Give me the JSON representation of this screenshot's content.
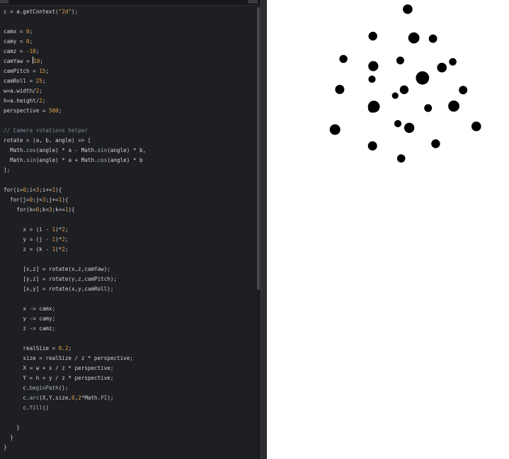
{
  "editor": {
    "language": "javascript",
    "cursor": {
      "line": 6,
      "column": 10
    },
    "colors": {
      "background": "#1e1f22",
      "default": "#d4d4d4",
      "keyword": "#d4d4d4",
      "number": "#e2a14a",
      "string": "#d9a55c",
      "property": "#a9b0b8",
      "comment": "#7b8799",
      "operator": "#d4d4d4"
    },
    "lines": [
      [
        {
          "t": "c = a.getContext(",
          "k": "default"
        },
        {
          "t": "\"2d\"",
          "k": "string"
        },
        {
          "t": ");",
          "k": "default"
        }
      ],
      [],
      [
        {
          "t": "camx = ",
          "k": "default"
        },
        {
          "t": "0",
          "k": "number"
        },
        {
          "t": ";",
          "k": "default"
        }
      ],
      [
        {
          "t": "camy = ",
          "k": "default"
        },
        {
          "t": "0",
          "k": "number"
        },
        {
          "t": ";",
          "k": "default"
        }
      ],
      [
        {
          "t": "camz = ",
          "k": "default"
        },
        {
          "t": "-10",
          "k": "number"
        },
        {
          "t": ";",
          "k": "default"
        }
      ],
      [
        {
          "t": "camYaw = ",
          "k": "default"
        },
        {
          "t": "10",
          "k": "number"
        },
        {
          "t": ";",
          "k": "default"
        }
      ],
      [
        {
          "t": "camPitch = ",
          "k": "default"
        },
        {
          "t": "15",
          "k": "number"
        },
        {
          "t": ";",
          "k": "default"
        }
      ],
      [
        {
          "t": "camRoll = ",
          "k": "default"
        },
        {
          "t": "25",
          "k": "number"
        },
        {
          "t": ";",
          "k": "default"
        }
      ],
      [
        {
          "t": "w=a.width/",
          "k": "default"
        },
        {
          "t": "2",
          "k": "number"
        },
        {
          "t": ";",
          "k": "default"
        }
      ],
      [
        {
          "t": "h=a.height/",
          "k": "default"
        },
        {
          "t": "2",
          "k": "number"
        },
        {
          "t": ";",
          "k": "default"
        }
      ],
      [
        {
          "t": "perspective = ",
          "k": "default"
        },
        {
          "t": "500",
          "k": "number"
        },
        {
          "t": ";",
          "k": "default"
        }
      ],
      [],
      [
        {
          "t": "// Camera rotations helper",
          "k": "comment"
        }
      ],
      [
        {
          "t": "rotate = (a, b, angle) => [",
          "k": "default"
        }
      ],
      [
        {
          "t": "  Math.",
          "k": "default"
        },
        {
          "t": "cos",
          "k": "property"
        },
        {
          "t": "(angle) * a - Math.",
          "k": "default"
        },
        {
          "t": "sin",
          "k": "property"
        },
        {
          "t": "(angle) * b,",
          "k": "default"
        }
      ],
      [
        {
          "t": "  Math.",
          "k": "default"
        },
        {
          "t": "sin",
          "k": "property"
        },
        {
          "t": "(angle) * a + Math.",
          "k": "default"
        },
        {
          "t": "cos",
          "k": "property"
        },
        {
          "t": "(angle) * b",
          "k": "default"
        }
      ],
      [
        {
          "t": "];",
          "k": "default"
        }
      ],
      [],
      [
        {
          "t": "for(i=",
          "k": "default"
        },
        {
          "t": "0",
          "k": "number"
        },
        {
          "t": ";i<",
          "k": "default"
        },
        {
          "t": "3",
          "k": "number"
        },
        {
          "t": ";i+=",
          "k": "default"
        },
        {
          "t": "1",
          "k": "number"
        },
        {
          "t": "){",
          "k": "default"
        }
      ],
      [
        {
          "t": "  for(j=",
          "k": "default"
        },
        {
          "t": "0",
          "k": "number"
        },
        {
          "t": ";j<",
          "k": "default"
        },
        {
          "t": "3",
          "k": "number"
        },
        {
          "t": ";j+=",
          "k": "default"
        },
        {
          "t": "1",
          "k": "number"
        },
        {
          "t": "){",
          "k": "default"
        }
      ],
      [
        {
          "t": "    for(k=",
          "k": "default"
        },
        {
          "t": "0",
          "k": "number"
        },
        {
          "t": ";k<",
          "k": "default"
        },
        {
          "t": "3",
          "k": "number"
        },
        {
          "t": ";k+=",
          "k": "default"
        },
        {
          "t": "1",
          "k": "number"
        },
        {
          "t": "){",
          "k": "default"
        }
      ],
      [],
      [
        {
          "t": "      x = (i - ",
          "k": "default"
        },
        {
          "t": "1",
          "k": "number"
        },
        {
          "t": ")*",
          "k": "default"
        },
        {
          "t": "2",
          "k": "number"
        },
        {
          "t": ";",
          "k": "default"
        }
      ],
      [
        {
          "t": "      y = (j - ",
          "k": "default"
        },
        {
          "t": "1",
          "k": "number"
        },
        {
          "t": ")*",
          "k": "default"
        },
        {
          "t": "2",
          "k": "number"
        },
        {
          "t": ";",
          "k": "default"
        }
      ],
      [
        {
          "t": "      z = (k - ",
          "k": "default"
        },
        {
          "t": "1",
          "k": "number"
        },
        {
          "t": ")*",
          "k": "default"
        },
        {
          "t": "2",
          "k": "number"
        },
        {
          "t": ";",
          "k": "default"
        }
      ],
      [],
      [
        {
          "t": "      [x,z] = rotate(x,z,camYaw);",
          "k": "default"
        }
      ],
      [
        {
          "t": "      [y,z] = rotate(y,z,camPitch);",
          "k": "default"
        }
      ],
      [
        {
          "t": "      [x,y] = rotate(x,y,camRoll);",
          "k": "default"
        }
      ],
      [],
      [
        {
          "t": "      x -= camx;",
          "k": "default"
        }
      ],
      [
        {
          "t": "      y -= camy;",
          "k": "default"
        }
      ],
      [
        {
          "t": "      z -= camz;",
          "k": "default"
        }
      ],
      [],
      [
        {
          "t": "      realSize = ",
          "k": "default"
        },
        {
          "t": "0.2",
          "k": "number"
        },
        {
          "t": ";",
          "k": "default"
        }
      ],
      [
        {
          "t": "      size = realSize / z * perspective;",
          "k": "default"
        }
      ],
      [
        {
          "t": "      X = w + x / z * perspective;",
          "k": "default"
        }
      ],
      [
        {
          "t": "      Y = h + y / z * perspective;",
          "k": "default"
        }
      ],
      [
        {
          "t": "      c.",
          "k": "default"
        },
        {
          "t": "beginPath",
          "k": "property"
        },
        {
          "t": "();",
          "k": "default"
        }
      ],
      [
        {
          "t": "      c.",
          "k": "default"
        },
        {
          "t": "arc",
          "k": "property"
        },
        {
          "t": "(X,Y,size,",
          "k": "default"
        },
        {
          "t": "0",
          "k": "number"
        },
        {
          "t": ",",
          "k": "default"
        },
        {
          "t": "2",
          "k": "number"
        },
        {
          "t": "*Math.",
          "k": "default"
        },
        {
          "t": "PI",
          "k": "property"
        },
        {
          "t": ");",
          "k": "default"
        }
      ],
      [
        {
          "t": "      c.",
          "k": "default"
        },
        {
          "t": "fill",
          "k": "property"
        },
        {
          "t": "()",
          "k": "default"
        }
      ],
      [],
      [
        {
          "t": "    }",
          "k": "default"
        }
      ],
      [
        {
          "t": "  }",
          "k": "default"
        }
      ],
      [
        {
          "t": "}",
          "k": "default"
        }
      ]
    ]
  },
  "canvas": {
    "background": "#ffffff",
    "dot_color": "#000000",
    "projection": {
      "camx": 0,
      "camy": 0,
      "camz": -10,
      "camYaw": 10,
      "camPitch": 15,
      "camRoll": 25,
      "perspective": 500,
      "realSize": 0.2,
      "grid": 3,
      "spacing": 2
    }
  }
}
